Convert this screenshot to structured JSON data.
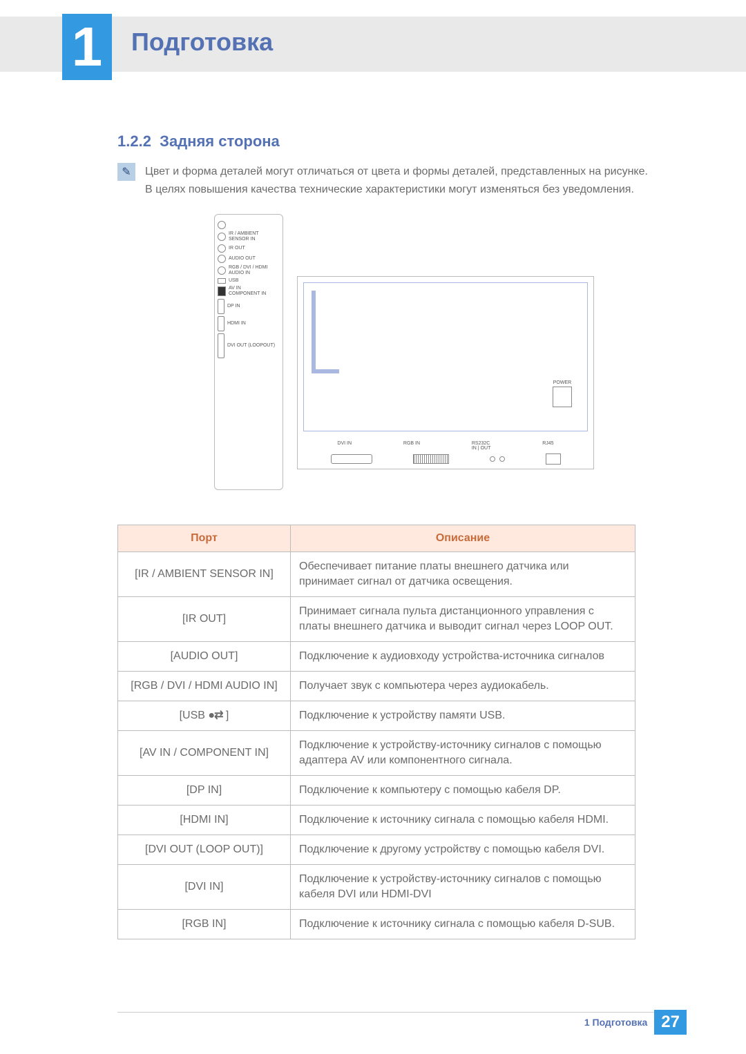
{
  "chapter": {
    "number": "1",
    "title": "Подготовка"
  },
  "section": {
    "number": "1.2.2",
    "title": "Задняя сторона"
  },
  "note": {
    "line1": "Цвет и форма деталей могут отличаться от цвета и формы деталей, представленных на рисунке.",
    "line2": "В целях повышения качества технические характеристики могут изменяться без уведомления."
  },
  "diagram_labels": {
    "ir_ambient": "IR / AMBIENT SENSOR IN",
    "ir_out": "IR OUT",
    "audio_out": "AUDIO OUT",
    "rgb_dvi_hdmi_audio_in": "RGB / DVI / HDMI AUDIO IN",
    "usb": "USB",
    "av_in": "AV IN",
    "component_in": "COMPONENT IN",
    "dp_in": "DP IN",
    "hdmi_in": "HDMI IN",
    "dvi_out_loopout": "DVI OUT (LOOPOUT)",
    "power": "POWER",
    "dvi_in": "DVI IN",
    "rgb_in": "RGB IN",
    "rs232c": "RS232C",
    "rs232c_in": "IN",
    "rs232c_out": "OUT",
    "rj45": "RJ45"
  },
  "table": {
    "head_port": "Порт",
    "head_desc": "Описание",
    "rows": [
      {
        "port": "[IR / AMBIENT SENSOR IN]",
        "desc": "Обеспечивает питание платы внешнего датчика или принимает сигнал от датчика освещения."
      },
      {
        "port": "[IR OUT]",
        "desc": "Принимает сигнала пульта дистанционного управления с платы внешнего датчика и выводит сигнал через LOOP OUT."
      },
      {
        "port": "[AUDIO OUT]",
        "desc": "Подключение к аудиовходу устройства-источника сигналов"
      },
      {
        "port": "[RGB / DVI / HDMI AUDIO IN]",
        "desc": "Получает звук с компьютера через аудиокабель."
      },
      {
        "port": "[USB ⟵⟶ ]",
        "desc": "Подключение к устройству памяти USB."
      },
      {
        "port": "[AV IN / COMPONENT IN]",
        "desc": "Подключение к устройству-источнику сигналов с помощью адаптера AV или компонентного сигнала."
      },
      {
        "port": "[DP IN]",
        "desc": "Подключение к компьютеру с помощью кабеля DP."
      },
      {
        "port": "[HDMI IN]",
        "desc": "Подключение к источнику сигнала с помощью кабеля HDMI."
      },
      {
        "port": "[DVI OUT (LOOP OUT)]",
        "desc": "Подключение к другому устройству с помощью кабеля DVI."
      },
      {
        "port": "[DVI IN]",
        "desc": "Подключение к устройству-источнику сигналов с помощью кабеля DVI или HDMI-DVI"
      },
      {
        "port": "[RGB IN]",
        "desc": "Подключение к источнику сигнала с помощью кабеля D-SUB."
      }
    ]
  },
  "footer": {
    "text": "1 Подготовка",
    "page": "27"
  }
}
